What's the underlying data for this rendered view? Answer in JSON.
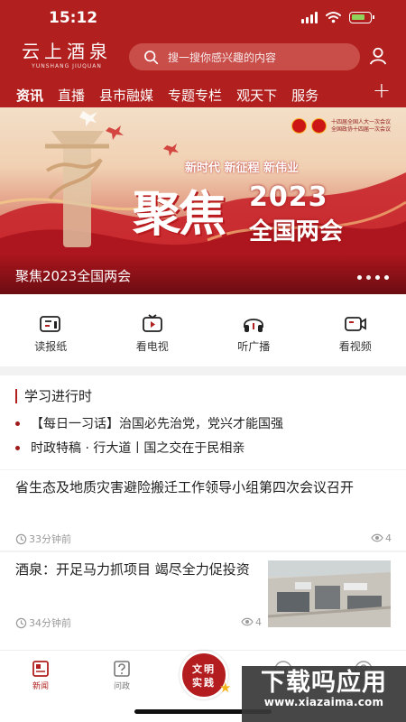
{
  "status_bar": {
    "time": "15:12"
  },
  "header": {
    "logo_text": "云上酒泉",
    "logo_subtitle": "YUNSHANG JIUQUAN",
    "search_placeholder": "搜一搜你感兴趣的内容",
    "tabs": [
      {
        "label": "资讯",
        "active": true
      },
      {
        "label": "直播"
      },
      {
        "label": "县市融媒"
      },
      {
        "label": "专题专栏"
      },
      {
        "label": "观天下"
      },
      {
        "label": "服务"
      }
    ],
    "add_tab_symbol": "+"
  },
  "banner": {
    "slogan": "新时代 新征程 新伟业",
    "focus_text": "聚焦",
    "year": "2023",
    "meeting": "全国两会",
    "caption": "聚焦2023全国两会",
    "badge_lines": [
      "十四届全国人大一次会议",
      "全国政协十四届一次会议"
    ],
    "dot_count": 4,
    "active_dot": 1
  },
  "quick_actions": [
    {
      "label": "读报纸",
      "icon": "newspaper-icon"
    },
    {
      "label": "看电视",
      "icon": "tv-icon"
    },
    {
      "label": "听广播",
      "icon": "headphones-icon"
    },
    {
      "label": "看视频",
      "icon": "video-camera-icon"
    }
  ],
  "study": {
    "title": "学习进行时",
    "items": [
      "【每日一习话】治国必先治党，党兴才能国强",
      "时政特稿 · 行大道丨国之交在于民相亲"
    ]
  },
  "news": [
    {
      "title": "省生态及地质灾害避险搬迁工作领导小组第四次会议召开",
      "time": "33分钟前",
      "views": "4"
    },
    {
      "title": "酒泉：开足马力抓项目 竭尽全力促投资",
      "time": "34分钟前",
      "views": "4"
    }
  ],
  "bottom_nav": {
    "items": [
      {
        "label": "新闻",
        "icon": "news-icon",
        "active": true
      },
      {
        "label": "问政",
        "icon": "question-icon"
      }
    ],
    "center_lines": [
      "文明",
      "实践"
    ]
  },
  "watermark": {
    "title": "下载吗应用",
    "site": "www.xiazaima.com"
  },
  "colors": {
    "brand": "#b1201e",
    "accent": "#f4b41a"
  }
}
